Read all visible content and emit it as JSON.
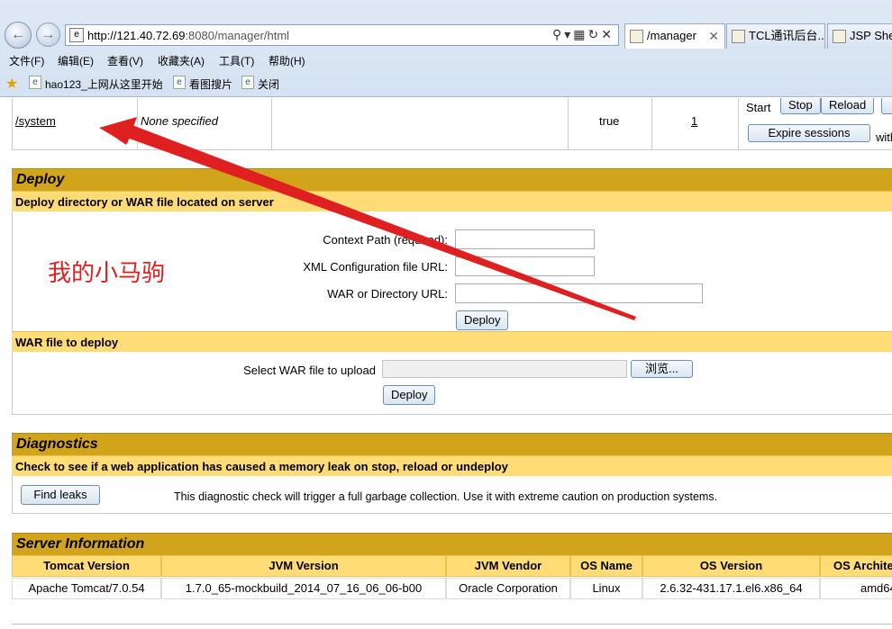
{
  "browser": {
    "url_host": "http://121.40.72.69",
    "url_path": ":8080/manager/html",
    "tabs": [
      {
        "label": "/manager"
      },
      {
        "label": "TCL通讯后台..."
      },
      {
        "label": "JSP Shel"
      }
    ],
    "menu": [
      "文件(F)",
      "编辑(E)",
      "查看(V)",
      "收藏夹(A)",
      "工具(T)",
      "帮助(H)"
    ],
    "favorites": [
      "hao123_上网从这里开始",
      "看图搜片",
      "关闭"
    ]
  },
  "app_row": {
    "path": "/system",
    "display_name": "None specified",
    "running": "true",
    "sessions": "1",
    "start_label": "Start",
    "stop_label": "Stop",
    "reload_label": "Reload",
    "expire_label": "Expire sessions",
    "with_label": "with"
  },
  "deploy": {
    "title": "Deploy",
    "server_subtitle": "Deploy directory or WAR file located on server",
    "context_path_label": "Context Path (required):",
    "xml_config_label": "XML Configuration file URL:",
    "war_dir_label": "WAR or Directory URL:",
    "deploy_button": "Deploy",
    "war_subtitle": "WAR file to deploy",
    "select_war_label": "Select WAR file to upload",
    "browse_button": "浏览...",
    "deploy_button_2": "Deploy"
  },
  "diagnostics": {
    "title": "Diagnostics",
    "subtitle": "Check to see if a web application has caused a memory leak on stop, reload or undeploy",
    "find_leaks_button": "Find leaks",
    "description": "This diagnostic check will trigger a full garbage collection. Use it with extreme caution on production systems."
  },
  "server_info": {
    "title": "Server Information",
    "headers": [
      "Tomcat Version",
      "JVM Version",
      "JVM Vendor",
      "OS Name",
      "OS Version",
      "OS Archite"
    ],
    "values": [
      "Apache Tomcat/7.0.54",
      "1.7.0_65-mockbuild_2014_07_16_06_06-b00",
      "Oracle Corporation",
      "Linux",
      "2.6.32-431.17.1.el6.x86_64",
      "amd64"
    ]
  },
  "annotation": {
    "text": "我的小马驹",
    "color": "#e02020"
  }
}
